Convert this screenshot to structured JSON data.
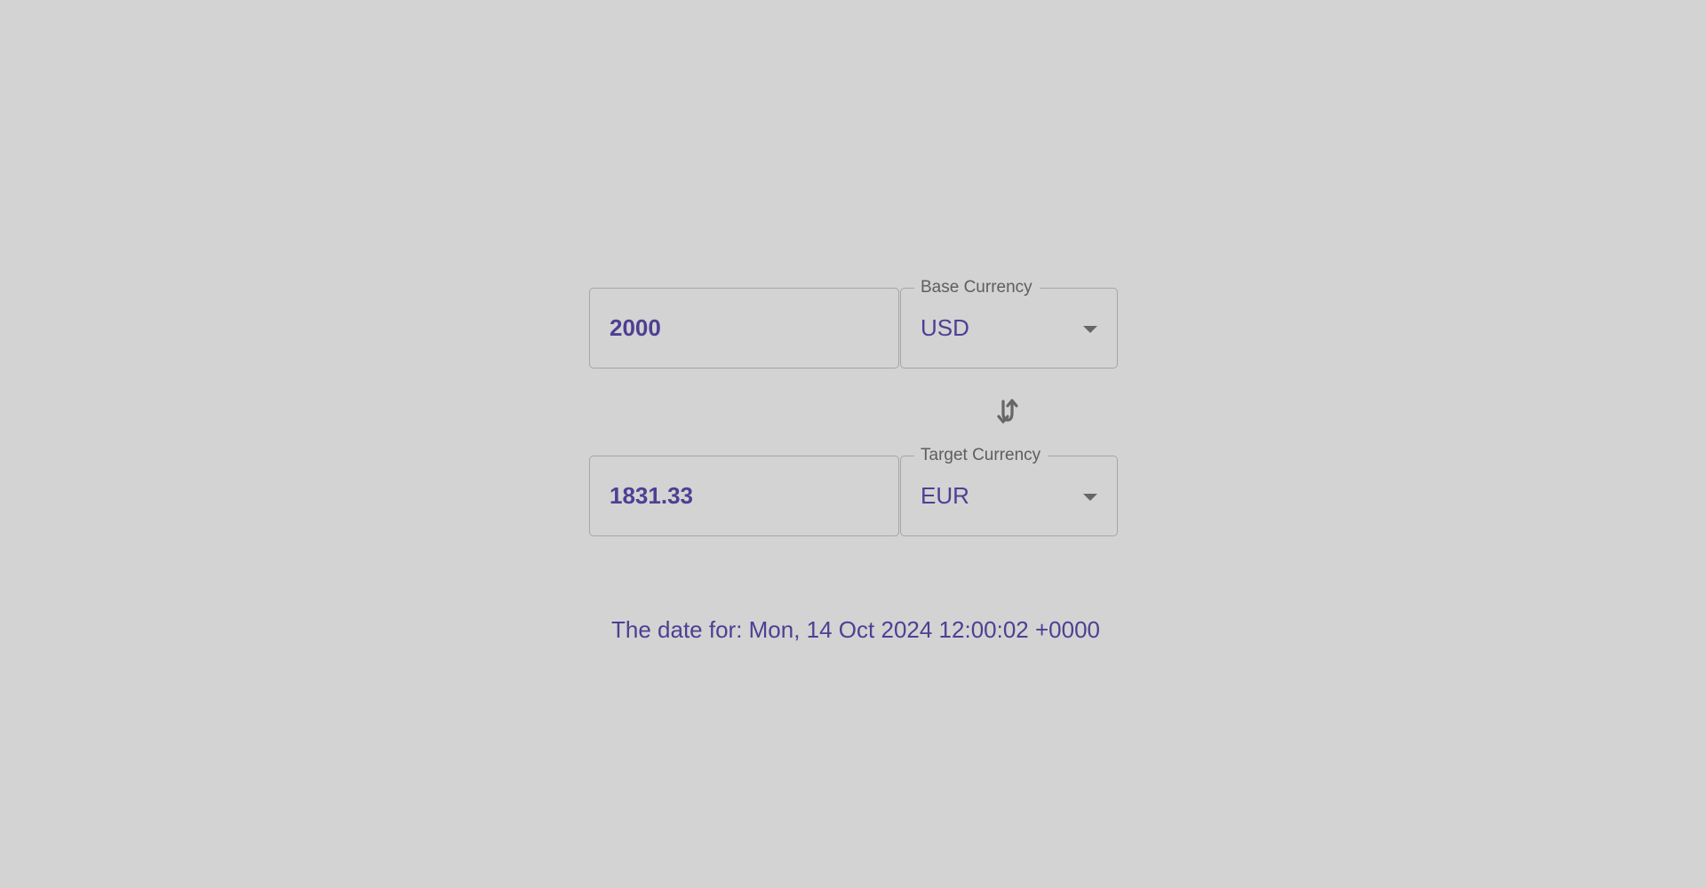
{
  "converter": {
    "base": {
      "amount": "2000",
      "currency_label": "Base Currency",
      "currency_value": "USD"
    },
    "target": {
      "amount": "1831.33",
      "currency_label": "Target Currency",
      "currency_value": "EUR"
    },
    "swap_icon": "swap-vertical-icon",
    "date_text": "The date for: Mon, 14 Oct 2024 12:00:02 +0000"
  },
  "colors": {
    "background": "#d3d3d3",
    "accent": "#4e3f93",
    "border": "#a6a6a6",
    "label": "#5e5e5e",
    "icon": "#666666"
  }
}
